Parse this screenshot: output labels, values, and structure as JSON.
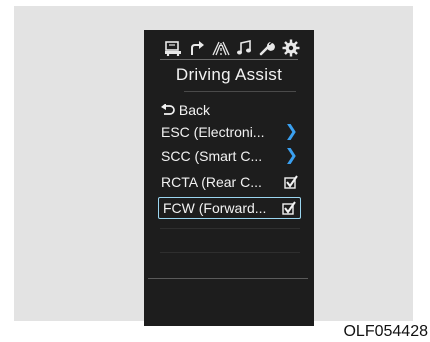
{
  "screen": {
    "title": "Driving Assist",
    "icons": [
      "vehicle-settings-icon",
      "navigation-arrow-icon",
      "lane-road-icon",
      "music-note-icon",
      "wrench-icon",
      "gear-icon"
    ],
    "menu": {
      "back": "Back",
      "items": [
        {
          "label": "ESC (Electroni...",
          "trailing": "chevron"
        },
        {
          "label": "SCC (Smart C...",
          "trailing": "chevron"
        },
        {
          "label": "RCTA (Rear C...",
          "trailing": "checkbox",
          "checked": true
        },
        {
          "label": "FCW (Forward...",
          "trailing": "checkbox",
          "checked": true,
          "selected": true
        }
      ]
    }
  },
  "caption": "OLF054428",
  "colors": {
    "screen_bg": "#1d1d1d",
    "accent_blue": "#3aa0f0",
    "highlight_border": "#9bd6f0"
  }
}
